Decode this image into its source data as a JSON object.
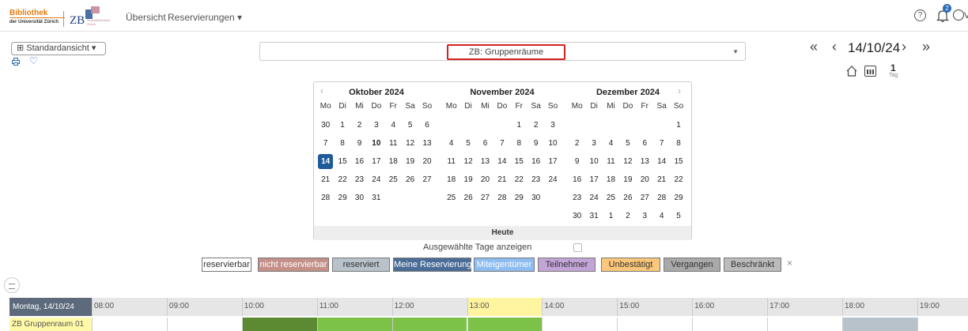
{
  "header": {
    "logo_line1": "Bibliothek",
    "logo_line2": "der Universität Zürich",
    "logo2_text": "ZB",
    "logo2_sub": "Zentralbibliothek Zürich",
    "nav_overview": "Übersicht",
    "nav_reservations": "Reservierungen ▾",
    "help_icon": "question-circle-icon",
    "bell_icon": "bell-icon",
    "notification_count": "2",
    "user_icon": "user-circle-icon",
    "user_label": "V"
  },
  "toolbar": {
    "view_label": "⊞ Standardansicht ▾",
    "print_icon": "print-icon",
    "favorite_icon": "heart-icon",
    "resource_value": "ZB: Gruppenräume",
    "date_display": "14/10/24",
    "day_count": "1",
    "day_unit": "Tag"
  },
  "calendar": {
    "weekdays": [
      "Mo",
      "Di",
      "Mi",
      "Do",
      "Fr",
      "Sa",
      "So"
    ],
    "today_label": "Heute",
    "months": [
      {
        "title": "Oktober 2024",
        "weeks": [
          [
            "30",
            "1",
            "2",
            "3",
            "4",
            "5",
            "6"
          ],
          [
            "7",
            "8",
            "9",
            "10",
            "11",
            "12",
            "13"
          ],
          [
            "14",
            "15",
            "16",
            "17",
            "18",
            "19",
            "20"
          ],
          [
            "21",
            "22",
            "23",
            "24",
            "25",
            "26",
            "27"
          ],
          [
            "28",
            "29",
            "30",
            "31",
            "",
            "",
            ""
          ],
          [
            "",
            "",
            "",
            "",
            "",
            "",
            ""
          ]
        ]
      },
      {
        "title": "November 2024",
        "weeks": [
          [
            "",
            "",
            "",
            "",
            "1",
            "2",
            "3"
          ],
          [
            "4",
            "5",
            "6",
            "7",
            "8",
            "9",
            "10"
          ],
          [
            "11",
            "12",
            "13",
            "14",
            "15",
            "16",
            "17"
          ],
          [
            "18",
            "19",
            "20",
            "21",
            "22",
            "23",
            "24"
          ],
          [
            "25",
            "26",
            "27",
            "28",
            "29",
            "30",
            ""
          ],
          [
            "",
            "",
            "",
            "",
            "",
            "",
            ""
          ]
        ]
      },
      {
        "title": "Dezember 2024",
        "weeks": [
          [
            "",
            "",
            "",
            "",
            "",
            "",
            "1"
          ],
          [
            "2",
            "3",
            "4",
            "5",
            "6",
            "7",
            "8"
          ],
          [
            "9",
            "10",
            "11",
            "12",
            "13",
            "14",
            "15"
          ],
          [
            "16",
            "17",
            "18",
            "19",
            "20",
            "21",
            "22"
          ],
          [
            "23",
            "24",
            "25",
            "26",
            "27",
            "28",
            "29"
          ],
          [
            "30",
            "31",
            "1",
            "2",
            "3",
            "4",
            "5"
          ]
        ]
      }
    ],
    "today_day": "10",
    "selected_day": "14",
    "show_selected_label": "Ausgewählte Tage anzeigen"
  },
  "legend": [
    {
      "label": "reservierbar",
      "bg": "#ffffff",
      "fg": "#333333"
    },
    {
      "label": "nicht reservierbar",
      "bg": "#c49089",
      "fg": "#ffffff"
    },
    {
      "label": "reserviert",
      "bg": "#b7c2cb",
      "fg": "#333333"
    },
    {
      "label": "Meine Reservierung",
      "bg": "#4a6c96",
      "fg": "#ffffff"
    },
    {
      "label": "Miteigentümer",
      "bg": "#8cbcf0",
      "fg": "#ffffff"
    },
    {
      "label": "Teilnehmer",
      "bg": "#c3a4d7",
      "fg": "#333333"
    },
    {
      "label": "Unbestätigt",
      "bg": "#fbc77a",
      "fg": "#333333"
    },
    {
      "label": "Vergangen",
      "bg": "#a9a9a9",
      "fg": "#333333"
    },
    {
      "label": "Beschränkt",
      "bg": "#bbbbbb",
      "fg": "#333333"
    }
  ],
  "schedule": {
    "day_label": "Montag, 14/10/24",
    "hours": [
      "08:00",
      "09:00",
      "10:00",
      "11:00",
      "12:00",
      "13:00",
      "14:00",
      "15:00",
      "16:00",
      "17:00",
      "18:00",
      "19:00"
    ],
    "highlight_hour": "13:00",
    "room": "ZB Gruppenraum 01",
    "room_cells": [
      "#ffffff",
      "#ffffff",
      "#5b8a32",
      "#7cc248",
      "#7cc248",
      "#7cc248",
      "#ffffff",
      "#ffffff",
      "#ffffff",
      "#ffffff",
      "#b7c2cb",
      "#ffffff"
    ]
  }
}
